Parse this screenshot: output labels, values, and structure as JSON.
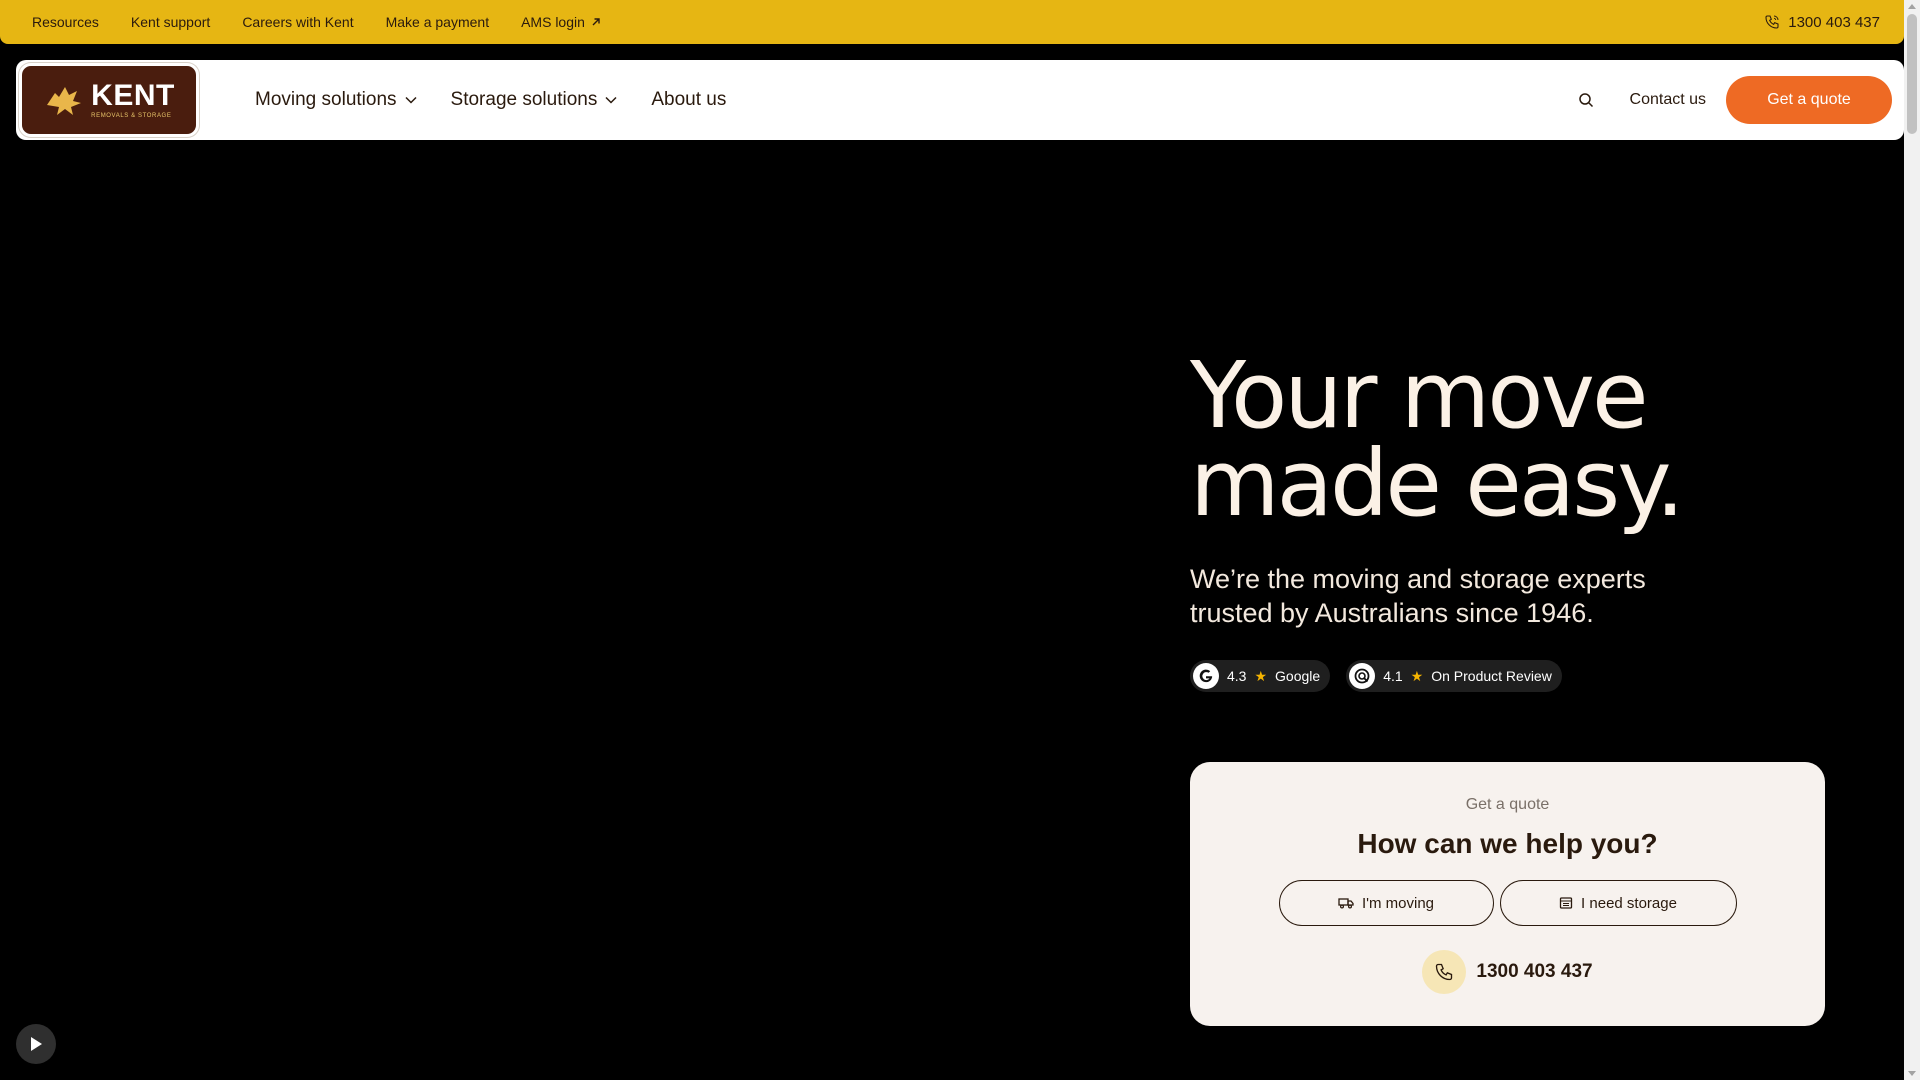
{
  "utility": {
    "links": [
      "Resources",
      "Kent support",
      "Careers with Kent",
      "Make a payment",
      "AMS login"
    ],
    "phone": "1300 403 437"
  },
  "brand": {
    "name": "KENT",
    "tagline": "REMOVALS & STORAGE"
  },
  "nav": {
    "items": [
      "Moving solutions",
      "Storage solutions",
      "About us"
    ],
    "contact": "Contact us",
    "cta": "Get a quote"
  },
  "hero": {
    "title_line1": "Your move",
    "title_line2": "made easy.",
    "subtitle": "We’re the moving and storage experts trusted by Australians since 1946.",
    "ratings": [
      {
        "score": "4.3",
        "source": "Google"
      },
      {
        "score": "4.1",
        "source": "On Product Review"
      }
    ]
  },
  "quote_card": {
    "eyebrow": "Get a quote",
    "heading": "How can we help you?",
    "option_moving": "I'm moving",
    "option_storage": "I need storage",
    "phone": "1300 403 437"
  },
  "colors": {
    "utility_bg": "#e6b613",
    "cta": "#ee6a24",
    "logo_bg": "#4a1d0e",
    "card_bg": "#f7f2ee"
  }
}
